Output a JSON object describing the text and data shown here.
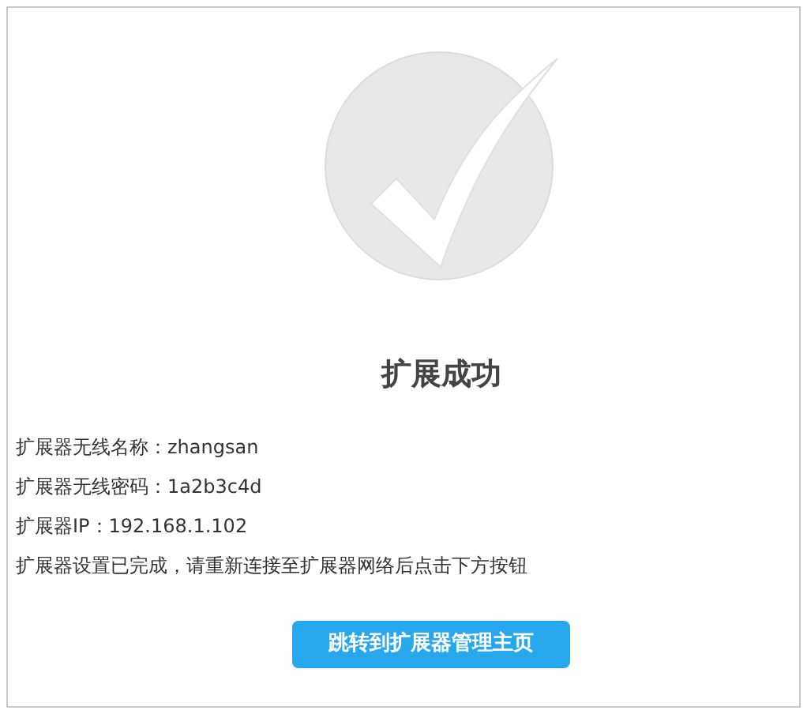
{
  "title": "扩展成功",
  "info": [
    {
      "label": "扩展器无线名称：",
      "value": "zhangsan"
    },
    {
      "label": "扩展器无线密码：",
      "value": "1a2b3c4d"
    },
    {
      "label": "扩展器IP：",
      "value": "192.168.1.102"
    }
  ],
  "message": "扩展器设置已完成，请重新连接至扩展器网络后点击下方按钮",
  "button": "跳转到扩展器管理主页"
}
